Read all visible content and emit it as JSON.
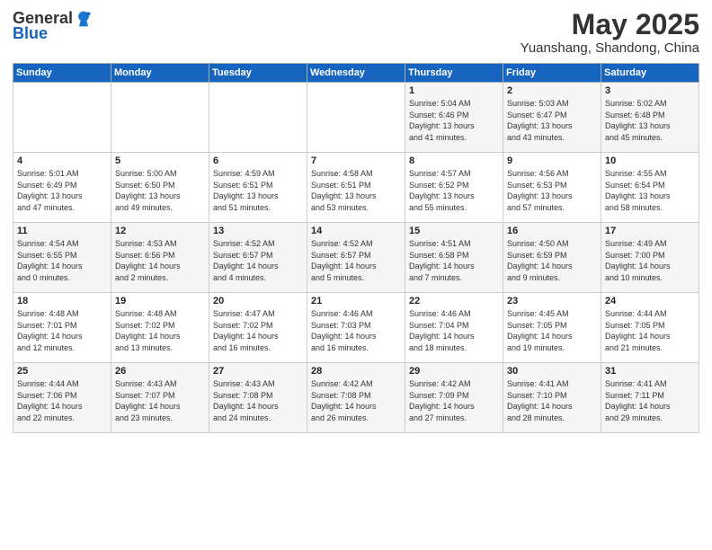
{
  "logo": {
    "general": "General",
    "blue": "Blue"
  },
  "title": "May 2025",
  "location": "Yuanshang, Shandong, China",
  "days_of_week": [
    "Sunday",
    "Monday",
    "Tuesday",
    "Wednesday",
    "Thursday",
    "Friday",
    "Saturday"
  ],
  "weeks": [
    [
      {
        "day": "",
        "info": ""
      },
      {
        "day": "",
        "info": ""
      },
      {
        "day": "",
        "info": ""
      },
      {
        "day": "",
        "info": ""
      },
      {
        "day": "1",
        "info": "Sunrise: 5:04 AM\nSunset: 6:46 PM\nDaylight: 13 hours\nand 41 minutes."
      },
      {
        "day": "2",
        "info": "Sunrise: 5:03 AM\nSunset: 6:47 PM\nDaylight: 13 hours\nand 43 minutes."
      },
      {
        "day": "3",
        "info": "Sunrise: 5:02 AM\nSunset: 6:48 PM\nDaylight: 13 hours\nand 45 minutes."
      }
    ],
    [
      {
        "day": "4",
        "info": "Sunrise: 5:01 AM\nSunset: 6:49 PM\nDaylight: 13 hours\nand 47 minutes."
      },
      {
        "day": "5",
        "info": "Sunrise: 5:00 AM\nSunset: 6:50 PM\nDaylight: 13 hours\nand 49 minutes."
      },
      {
        "day": "6",
        "info": "Sunrise: 4:59 AM\nSunset: 6:51 PM\nDaylight: 13 hours\nand 51 minutes."
      },
      {
        "day": "7",
        "info": "Sunrise: 4:58 AM\nSunset: 6:51 PM\nDaylight: 13 hours\nand 53 minutes."
      },
      {
        "day": "8",
        "info": "Sunrise: 4:57 AM\nSunset: 6:52 PM\nDaylight: 13 hours\nand 55 minutes."
      },
      {
        "day": "9",
        "info": "Sunrise: 4:56 AM\nSunset: 6:53 PM\nDaylight: 13 hours\nand 57 minutes."
      },
      {
        "day": "10",
        "info": "Sunrise: 4:55 AM\nSunset: 6:54 PM\nDaylight: 13 hours\nand 58 minutes."
      }
    ],
    [
      {
        "day": "11",
        "info": "Sunrise: 4:54 AM\nSunset: 6:55 PM\nDaylight: 14 hours\nand 0 minutes."
      },
      {
        "day": "12",
        "info": "Sunrise: 4:53 AM\nSunset: 6:56 PM\nDaylight: 14 hours\nand 2 minutes."
      },
      {
        "day": "13",
        "info": "Sunrise: 4:52 AM\nSunset: 6:57 PM\nDaylight: 14 hours\nand 4 minutes."
      },
      {
        "day": "14",
        "info": "Sunrise: 4:52 AM\nSunset: 6:57 PM\nDaylight: 14 hours\nand 5 minutes."
      },
      {
        "day": "15",
        "info": "Sunrise: 4:51 AM\nSunset: 6:58 PM\nDaylight: 14 hours\nand 7 minutes."
      },
      {
        "day": "16",
        "info": "Sunrise: 4:50 AM\nSunset: 6:59 PM\nDaylight: 14 hours\nand 9 minutes."
      },
      {
        "day": "17",
        "info": "Sunrise: 4:49 AM\nSunset: 7:00 PM\nDaylight: 14 hours\nand 10 minutes."
      }
    ],
    [
      {
        "day": "18",
        "info": "Sunrise: 4:48 AM\nSunset: 7:01 PM\nDaylight: 14 hours\nand 12 minutes."
      },
      {
        "day": "19",
        "info": "Sunrise: 4:48 AM\nSunset: 7:02 PM\nDaylight: 14 hours\nand 13 minutes."
      },
      {
        "day": "20",
        "info": "Sunrise: 4:47 AM\nSunset: 7:02 PM\nDaylight: 14 hours\nand 16 minutes."
      },
      {
        "day": "21",
        "info": "Sunrise: 4:46 AM\nSunset: 7:03 PM\nDaylight: 14 hours\nand 16 minutes."
      },
      {
        "day": "22",
        "info": "Sunrise: 4:46 AM\nSunset: 7:04 PM\nDaylight: 14 hours\nand 18 minutes."
      },
      {
        "day": "23",
        "info": "Sunrise: 4:45 AM\nSunset: 7:05 PM\nDaylight: 14 hours\nand 19 minutes."
      },
      {
        "day": "24",
        "info": "Sunrise: 4:44 AM\nSunset: 7:05 PM\nDaylight: 14 hours\nand 21 minutes."
      }
    ],
    [
      {
        "day": "25",
        "info": "Sunrise: 4:44 AM\nSunset: 7:06 PM\nDaylight: 14 hours\nand 22 minutes."
      },
      {
        "day": "26",
        "info": "Sunrise: 4:43 AM\nSunset: 7:07 PM\nDaylight: 14 hours\nand 23 minutes."
      },
      {
        "day": "27",
        "info": "Sunrise: 4:43 AM\nSunset: 7:08 PM\nDaylight: 14 hours\nand 24 minutes."
      },
      {
        "day": "28",
        "info": "Sunrise: 4:42 AM\nSunset: 7:08 PM\nDaylight: 14 hours\nand 26 minutes."
      },
      {
        "day": "29",
        "info": "Sunrise: 4:42 AM\nSunset: 7:09 PM\nDaylight: 14 hours\nand 27 minutes."
      },
      {
        "day": "30",
        "info": "Sunrise: 4:41 AM\nSunset: 7:10 PM\nDaylight: 14 hours\nand 28 minutes."
      },
      {
        "day": "31",
        "info": "Sunrise: 4:41 AM\nSunset: 7:11 PM\nDaylight: 14 hours\nand 29 minutes."
      }
    ]
  ]
}
